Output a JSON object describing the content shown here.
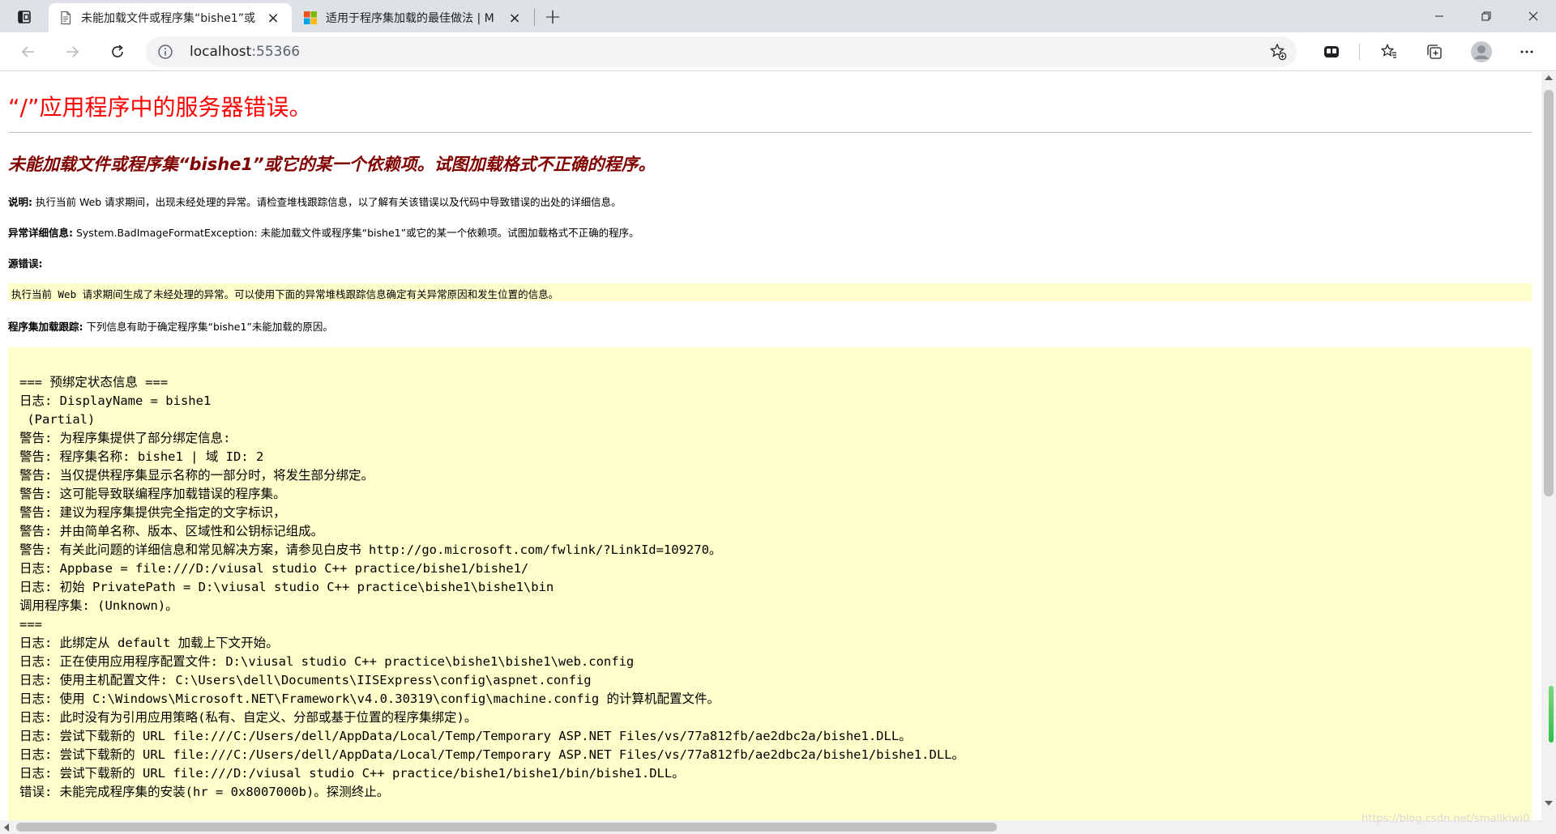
{
  "browser": {
    "tabs": [
      {
        "title": "未能加载文件或程序集“bishe1”或",
        "active": true,
        "close_label": "×"
      },
      {
        "title": "适用于程序集加载的最佳做法 | M",
        "active": false,
        "close_label": "×"
      }
    ],
    "new_tab_label": "+",
    "address": {
      "host": "localhost",
      "port": ":55366"
    },
    "window_controls": {
      "minimize_icon": "minimize-icon",
      "maximize_icon": "restore-icon",
      "close_icon": "close-icon"
    }
  },
  "page": {
    "title": "“/”应用程序中的服务器错误。",
    "error_heading": "未能加载文件或程序集“bishe1”或它的某一个依赖项。试图加载格式不正确的程序。",
    "description": {
      "label": "说明:",
      "text": " 执行当前 Web 请求期间，出现未经处理的异常。请检查堆栈跟踪信息，以了解有关该错误以及代码中导致错误的出处的详细信息。"
    },
    "exception_details": {
      "label": "异常详细信息:",
      "text": " System.BadImageFormatException: 未能加载文件或程序集“bishe1”或它的某一个依赖项。试图加载格式不正确的程序。"
    },
    "source_error": {
      "label": "源错误:",
      "text": "执行当前 Web 请求期间生成了未经处理的异常。可以使用下面的异常堆栈跟踪信息确定有关异常原因和发生位置的信息。"
    },
    "assembly_trace": {
      "label": "程序集加载跟踪:",
      "text": " 下列信息有助于确定程序集“bishe1”未能加载的原因。"
    },
    "trace_lines": [
      "=== 预绑定状态信息 ===",
      "日志: DisplayName = bishe1",
      " (Partial)",
      "警告: 为程序集提供了部分绑定信息:",
      "警告: 程序集名称: bishe1 | 域 ID: 2",
      "警告: 当仅提供程序集显示名称的一部分时，将发生部分绑定。",
      "警告: 这可能导致联编程序加载错误的程序集。",
      "警告: 建议为程序集提供完全指定的文字标识，",
      "警告: 并由简单名称、版本、区域性和公钥标记组成。",
      "警告: 有关此问题的详细信息和常见解决方案，请参见白皮书 http://go.microsoft.com/fwlink/?LinkId=109270。",
      "日志: Appbase = file:///D:/viusal studio C++ practice/bishe1/bishe1/",
      "日志: 初始 PrivatePath = D:\\viusal studio C++ practice\\bishe1\\bishe1\\bin",
      "调用程序集: (Unknown)。",
      "===",
      "日志: 此绑定从 default 加载上下文开始。",
      "日志: 正在使用应用程序配置文件: D:\\viusal studio C++ practice\\bishe1\\bishe1\\web.config",
      "日志: 使用主机配置文件: C:\\Users\\dell\\Documents\\IISExpress\\config\\aspnet.config",
      "日志: 使用 C:\\Windows\\Microsoft.NET\\Framework\\v4.0.30319\\config\\machine.config 的计算机配置文件。",
      "日志: 此时没有为引用应用策略(私有、自定义、分部或基于位置的程序集绑定)。",
      "日志: 尝试下载新的 URL file:///C:/Users/dell/AppData/Local/Temp/Temporary ASP.NET Files/vs/77a812fb/ae2dbc2a/bishe1.DLL。",
      "日志: 尝试下载新的 URL file:///C:/Users/dell/AppData/Local/Temp/Temporary ASP.NET Files/vs/77a812fb/ae2dbc2a/bishe1/bishe1.DLL。",
      "日志: 尝试下载新的 URL file:///D:/viusal studio C++ practice/bishe1/bishe1/bin/bishe1.DLL。",
      "错误: 未能完成程序集的安装(hr = 0x8007000b)。探测终止。"
    ]
  },
  "watermark": "https://blog.csdn.net/smallkiwi0",
  "colors": {
    "title_red": "#ff0000",
    "heading_maroon": "#800000",
    "code_background": "#ffffcc",
    "tabstrip": "#dee1e6"
  }
}
